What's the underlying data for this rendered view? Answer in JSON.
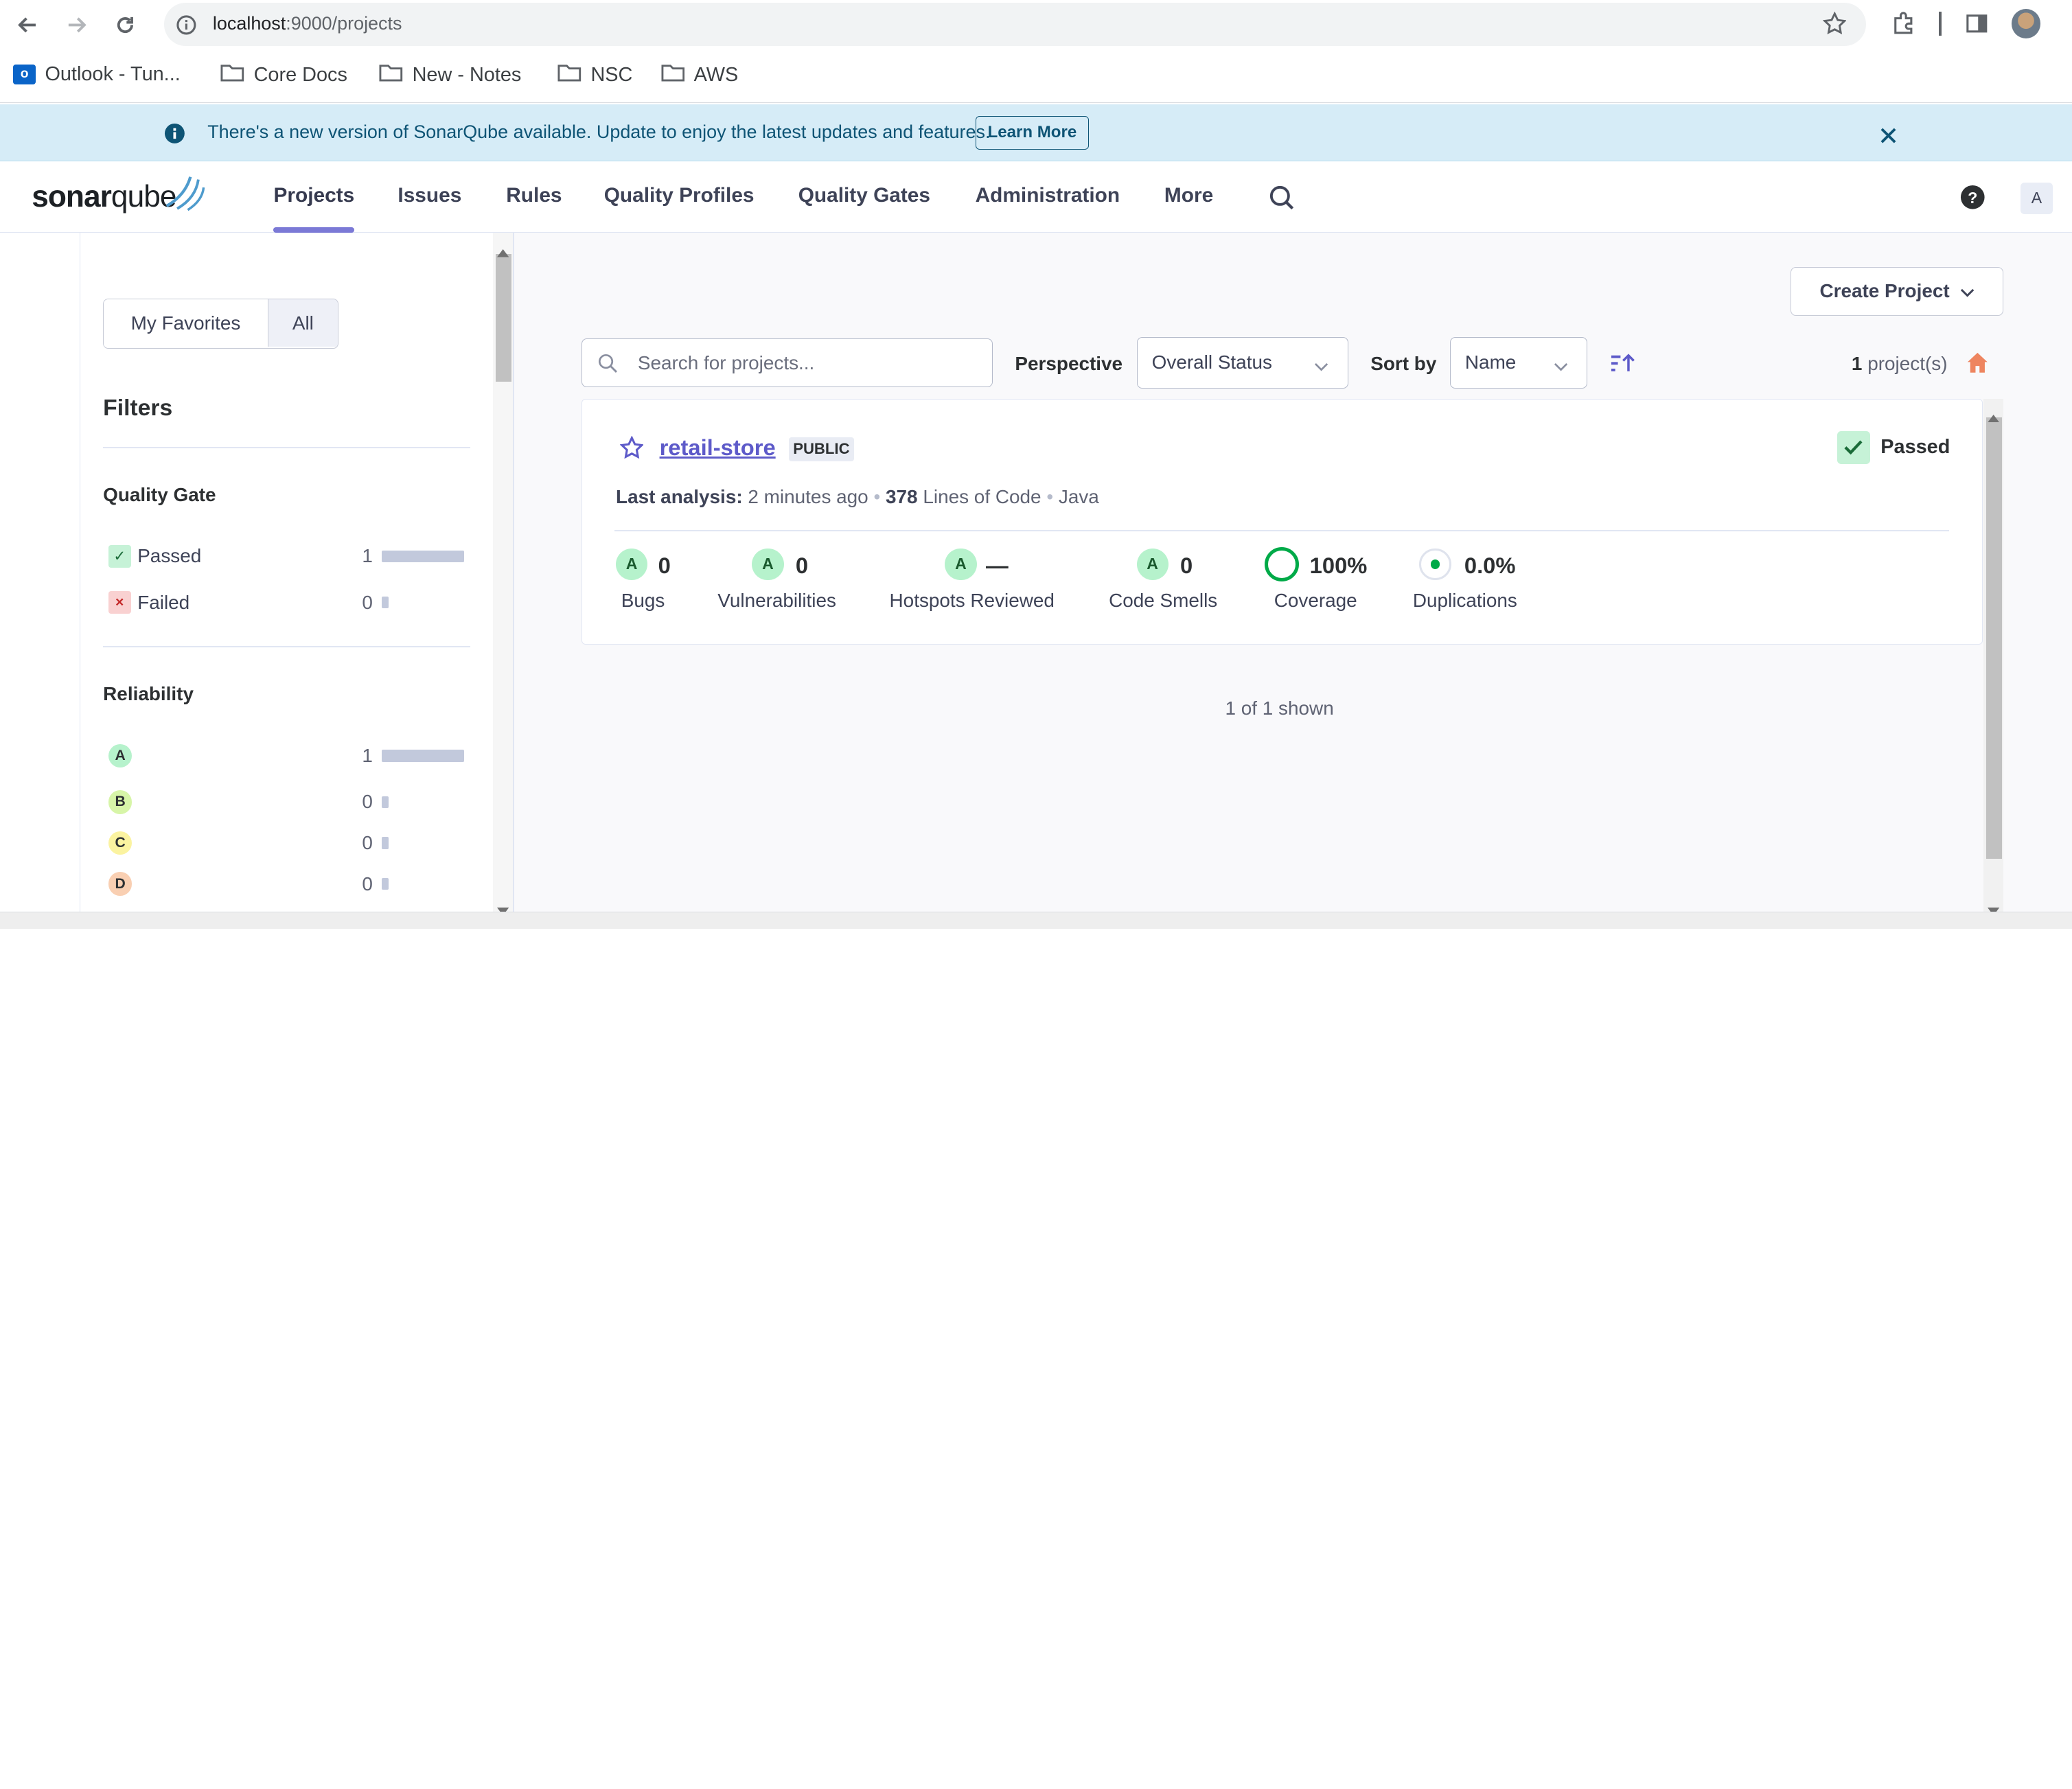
{
  "browser": {
    "url_host": "localhost",
    "url_path": ":9000/projects",
    "bookmarks": [
      {
        "label": "Outlook - Tun...",
        "icon": "outlook-icon"
      },
      {
        "label": "Core Docs",
        "icon": "folder-icon"
      },
      {
        "label": "New - Notes",
        "icon": "folder-icon"
      },
      {
        "label": "NSC",
        "icon": "folder-icon"
      },
      {
        "label": "AWS",
        "icon": "folder-icon"
      }
    ]
  },
  "banner": {
    "message": "There's a new version of SonarQube available. Update to enjoy the latest updates and features.",
    "learn_more": "Learn More"
  },
  "header": {
    "logo_bold": "sonar",
    "logo_light": "qube",
    "nav": [
      "Projects",
      "Issues",
      "Rules",
      "Quality Profiles",
      "Quality Gates",
      "Administration",
      "More"
    ],
    "active_nav": "Projects",
    "avatar_letter": "A"
  },
  "sidebar": {
    "toggle": {
      "favorites": "My Favorites",
      "all": "All"
    },
    "filters_title": "Filters",
    "quality_gate": {
      "title": "Quality Gate",
      "items": [
        {
          "label": "Passed",
          "count": "1",
          "fraction": 1.0
        },
        {
          "label": "Failed",
          "count": "0",
          "fraction": 0.0
        }
      ]
    },
    "reliability": {
      "title": "Reliability",
      "items": [
        {
          "label": "A",
          "count": "1",
          "fraction": 1.0,
          "color": "#b6f2cc"
        },
        {
          "label": "B",
          "count": "0",
          "fraction": 0.0,
          "color": "#d7f5a8"
        },
        {
          "label": "C",
          "count": "0",
          "fraction": 0.0,
          "color": "#fbf3a0"
        },
        {
          "label": "D",
          "count": "0",
          "fraction": 0.0,
          "color": "#f9cfb2"
        }
      ]
    }
  },
  "toolbar": {
    "create_project": "Create Project",
    "search_placeholder": "Search for projects...",
    "perspective_label": "Perspective",
    "perspective_value": "Overall Status",
    "sort_label": "Sort by",
    "sort_value": "Name",
    "project_count": "1",
    "project_count_suffix": " project(s)"
  },
  "project": {
    "name": "retail-store",
    "visibility": "PUBLIC",
    "quality_gate": "Passed",
    "last_analysis_label": "Last analysis:",
    "last_analysis": "2 minutes ago",
    "loc": "378",
    "loc_label": "Lines of Code",
    "language": "Java",
    "metrics": {
      "bugs": {
        "rating": "A",
        "value": "0",
        "label": "Bugs"
      },
      "vulnerabilities": {
        "rating": "A",
        "value": "0",
        "label": "Vulnerabilities"
      },
      "hotspots": {
        "rating": "A",
        "value": "—",
        "label": "Hotspots Reviewed"
      },
      "code_smells": {
        "rating": "A",
        "value": "0",
        "label": "Code Smells"
      },
      "coverage": {
        "value": "100%",
        "label": "Coverage"
      },
      "duplications": {
        "value": "0.0%",
        "label": "Duplications"
      }
    }
  },
  "footer": {
    "shown": "1 of 1 shown"
  }
}
